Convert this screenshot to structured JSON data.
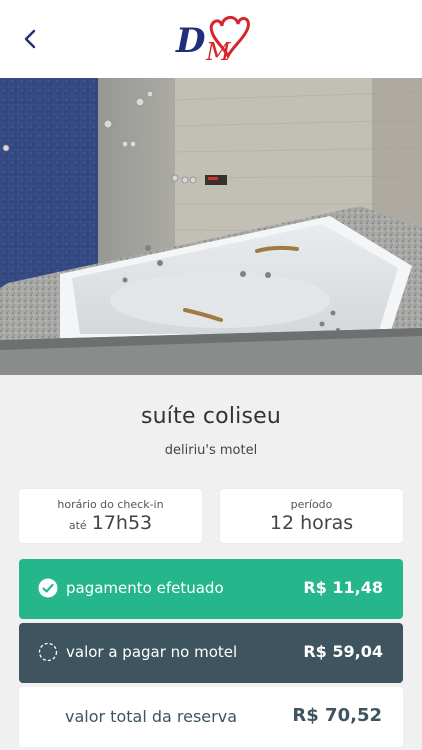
{
  "header": {
    "back_icon": "chevron-left-icon",
    "logo_text": "DM"
  },
  "suite": {
    "name": "suíte coliseu",
    "motel": "deliriu's motel"
  },
  "checkin": {
    "label": "horário do check-in",
    "prefix": "até",
    "time": "17h53"
  },
  "periodo": {
    "label": "período",
    "value": "12 horas"
  },
  "payments": {
    "paid": {
      "label": "pagamento efetuado",
      "amount": "R$ 11,48",
      "icon": "check-circle-icon",
      "color": "#26b68c"
    },
    "due": {
      "label": "valor a pagar no motel",
      "amount": "R$ 59,04",
      "icon": "dashed-circle-icon",
      "color": "#3e5560"
    },
    "total": {
      "label": "valor total da reserva",
      "amount": "R$ 70,52"
    }
  }
}
